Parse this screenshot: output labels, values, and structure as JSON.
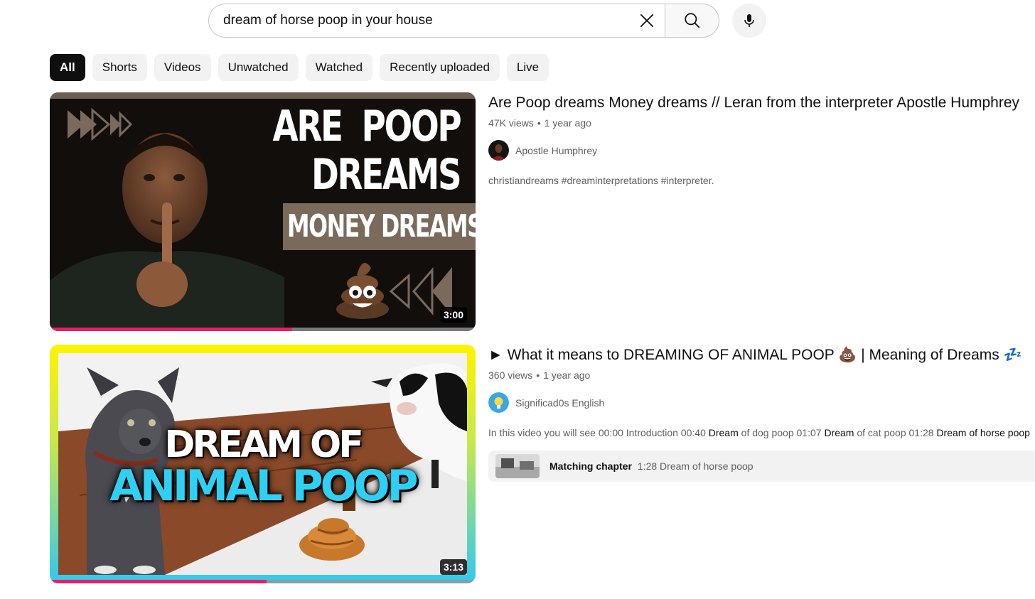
{
  "search": {
    "query": "dream of horse poop in your house",
    "clear_icon": "close-icon",
    "search_icon": "search-icon",
    "mic_icon": "mic-icon"
  },
  "chips": [
    {
      "label": "All",
      "active": true
    },
    {
      "label": "Shorts"
    },
    {
      "label": "Videos"
    },
    {
      "label": "Unwatched"
    },
    {
      "label": "Watched"
    },
    {
      "label": "Recently uploaded"
    },
    {
      "label": "Live"
    }
  ],
  "results": [
    {
      "title": "Are Poop dreams Money dreams // Leran from the interpreter Apostle Humphrey",
      "views": "47K views",
      "age": "1 year ago",
      "channel": "Apostle Humphrey",
      "description": "christiandreams #dreaminterpretations #interpreter.",
      "duration": "3:00",
      "watched_progress": 0.57,
      "thumbnail_text": {
        "line1": "ARE  POOP",
        "line2": "DREAMS",
        "banner": "MONEY DREAMS"
      }
    },
    {
      "title": "► What it means to DREAMING OF ANIMAL POOP 💩 | Meaning of Dreams 💤",
      "views": "360 views",
      "age": "1 year ago",
      "channel": "Significad0s English",
      "description_parts": {
        "p1": "In this video you will see 00:00 Introduction 00:40 ",
        "b1": "Dream",
        "p2": " of dog poop 01:07 ",
        "b2": "Dream",
        "p3": " of cat poop 01:28 ",
        "b3": "Dream of horse poop"
      },
      "chapter_label": "Matching chapter",
      "chapter_text": "1:28 Dream of horse poop",
      "duration": "3:13",
      "watched_progress": 0.51,
      "thumbnail_text": {
        "line1": "DREAM OF",
        "line2": "ANIMAL POOP"
      }
    }
  ],
  "colors": {
    "progress": "#e91e63",
    "thumb2_top_border": "#fff200",
    "thumb2_bottom_border": "#33c8f0",
    "banner_brown": "#7a6a5c"
  }
}
